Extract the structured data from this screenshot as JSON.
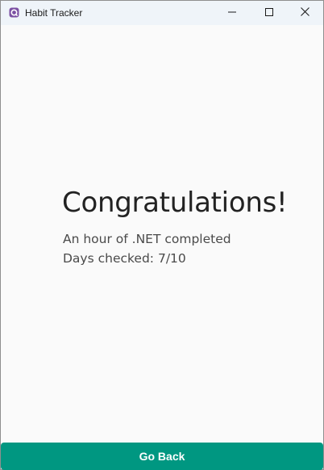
{
  "window": {
    "title": "Habit Tracker",
    "icon": "app-icon",
    "accent_color": "#009781"
  },
  "controls": {
    "minimize_icon": "minimize-icon",
    "maximize_icon": "maximize-icon",
    "close_icon": "close-icon"
  },
  "main": {
    "headline": "Congratulations!",
    "habit_text": "An hour of .NET completed",
    "days_text": "Days checked: 7/10"
  },
  "footer": {
    "go_back_label": "Go Back"
  }
}
